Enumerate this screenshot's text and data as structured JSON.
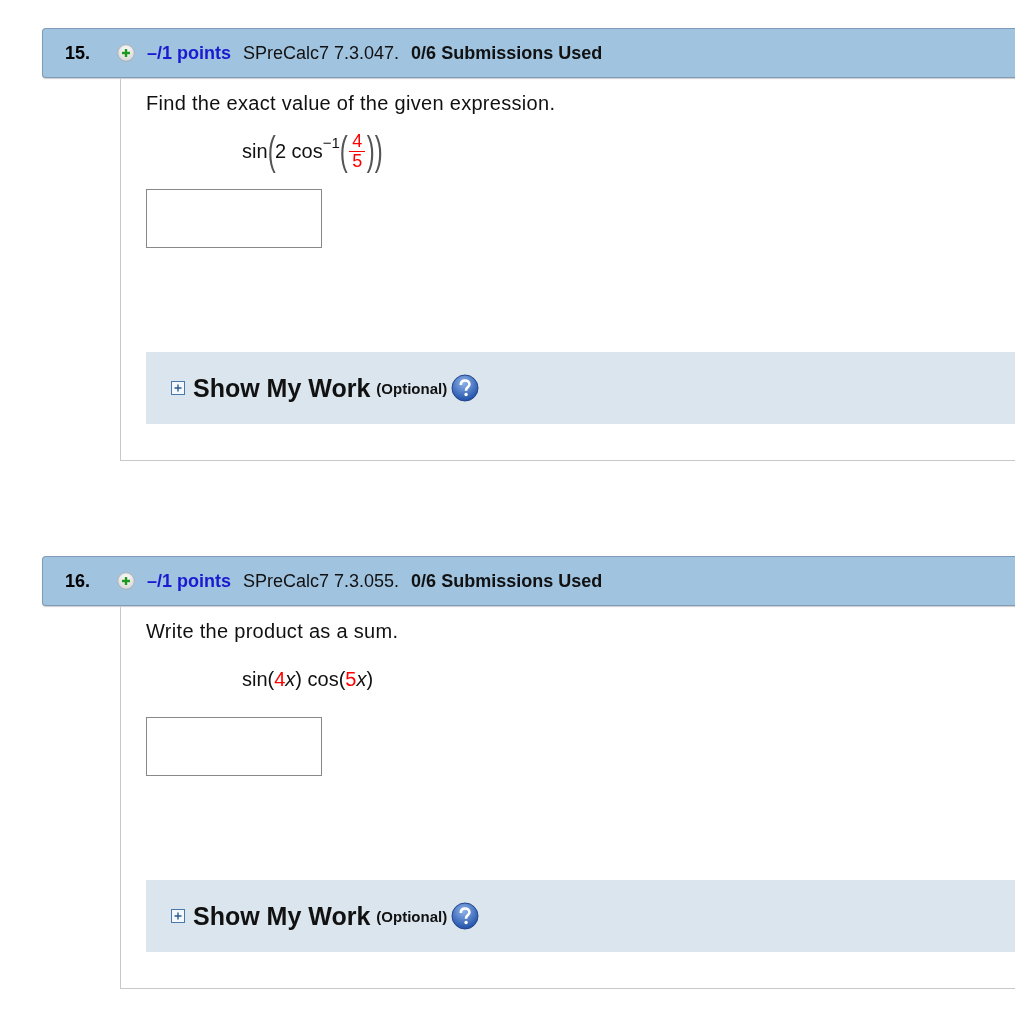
{
  "questions": [
    {
      "number": "15.",
      "points": "–/1 points",
      "source": "SPreCalc7 7.3.047.",
      "submissions": "0/6 Submissions Used",
      "prompt": "Find the exact value of the given expression.",
      "expression": [
        {
          "kind": "text",
          "text": "sin"
        },
        {
          "kind": "big",
          "text": "("
        },
        {
          "kind": "text",
          "text": "2 cos"
        },
        {
          "kind": "sup",
          "text": "−1"
        },
        {
          "kind": "big",
          "text": "("
        },
        {
          "kind": "frac",
          "num": "4",
          "den": "5"
        },
        {
          "kind": "big",
          "text": ")"
        },
        {
          "kind": "big",
          "text": ")"
        }
      ],
      "show_work": {
        "label": "Show My Work",
        "note": "(Optional)",
        "expanded": false
      }
    },
    {
      "number": "16.",
      "points": "–/1 points",
      "source": "SPreCalc7 7.3.055.",
      "submissions": "0/6 Submissions Used",
      "prompt": "Write the product as a sum.",
      "expression": [
        {
          "kind": "text",
          "text": "sin("
        },
        {
          "kind": "given",
          "text": "4"
        },
        {
          "kind": "var",
          "text": "x"
        },
        {
          "kind": "text",
          "text": ") cos("
        },
        {
          "kind": "given",
          "text": "5"
        },
        {
          "kind": "var",
          "text": "x"
        },
        {
          "kind": "text",
          "text": ")"
        }
      ],
      "show_work": {
        "label": "Show My Work",
        "note": "(Optional)",
        "expanded": false
      }
    }
  ]
}
